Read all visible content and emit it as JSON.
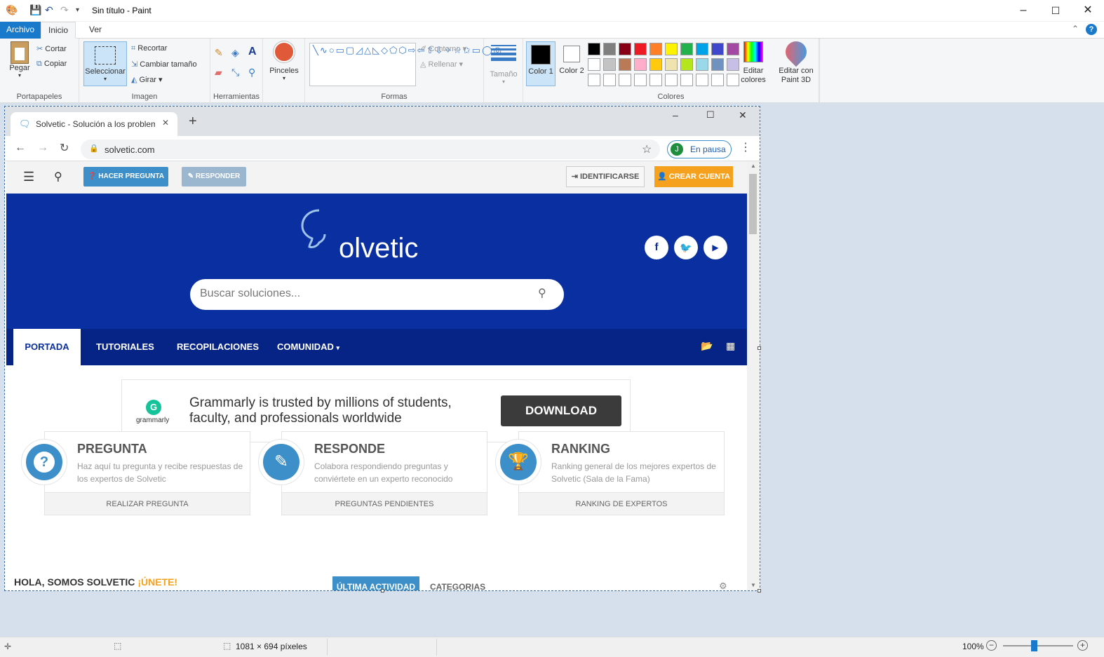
{
  "window": {
    "title": "Sin título - Paint"
  },
  "ribbon_tabs": {
    "file": "Archivo",
    "home": "Inicio",
    "view": "Ver"
  },
  "clipboard": {
    "paste": "Pegar",
    "cut": "Cortar",
    "copy": "Copiar",
    "group": "Portapapeles"
  },
  "image": {
    "select": "Seleccionar",
    "crop": "Recortar",
    "resize": "Cambiar tamaño",
    "rotate": "Girar",
    "group": "Imagen"
  },
  "tools": {
    "group": "Herramientas"
  },
  "brushes": {
    "label": "Pinceles"
  },
  "shapes": {
    "outline": "Contorno",
    "fill": "Rellenar",
    "group": "Formas"
  },
  "size": {
    "label": "Tamaño"
  },
  "colors": {
    "color1": "Color 1",
    "color2": "Color 2",
    "edit": "Editar colores",
    "group": "Colores",
    "palette_row1": [
      "#000000",
      "#7f7f7f",
      "#880015",
      "#ed1c24",
      "#ff7f27",
      "#fff200",
      "#22b14c",
      "#00a2e8",
      "#3f48cc",
      "#a349a4"
    ],
    "palette_row2": [
      "#ffffff",
      "#c3c3c3",
      "#b97a57",
      "#ffaec9",
      "#ffc90e",
      "#efe4b0",
      "#b5e61d",
      "#99d9ea",
      "#7092be",
      "#c8bfe7"
    ]
  },
  "paint3d": {
    "label": "Editar con Paint 3D"
  },
  "browser": {
    "tab_title": "Solvetic - Solución a los problem",
    "url": "solvetic.com",
    "profile_initial": "J",
    "profile_status": "En pausa"
  },
  "site": {
    "btn_ask": "HACER PREGUNTA",
    "btn_answer": "RESPONDER",
    "btn_login": "IDENTIFICARSE",
    "btn_signup": "CREAR CUENTA",
    "logo_text": "olvetic",
    "search_placeholder": "Buscar soluciones...",
    "nav": [
      "PORTADA",
      "TUTORIALES",
      "RECOPILACIONES",
      "COMUNIDAD"
    ],
    "ad_text_1": "Grammarly is trusted by millions of students,",
    "ad_text_2": "faculty, and professionals worldwide",
    "ad_brand": "grammarly",
    "ad_button": "DOWNLOAD",
    "cards": [
      {
        "title": "PREGUNTA",
        "desc": "Haz aquí tu pregunta y recibe respuestas de los expertos de Solvetic",
        "footer": "REALIZAR PREGUNTA"
      },
      {
        "title": "RESPONDE",
        "desc": "Colabora respondiendo preguntas y conviértete en un experto reconocido",
        "footer": "PREGUNTAS PENDIENTES"
      },
      {
        "title": "RANKING",
        "desc": "Ranking general de los mejores expertos de Solvetic (Sala de la Fama)",
        "footer": "RANKING DE EXPERTOS"
      }
    ],
    "hello": "HOLA, SOMOS SOLVETIC",
    "join": "¡ÚNETE!",
    "tab_activity": "ÚLTIMA ACTIVIDAD",
    "tab_categories": "CATEGORIAS"
  },
  "status": {
    "dimensions": "1081 × 694 píxeles",
    "zoom": "100%"
  }
}
